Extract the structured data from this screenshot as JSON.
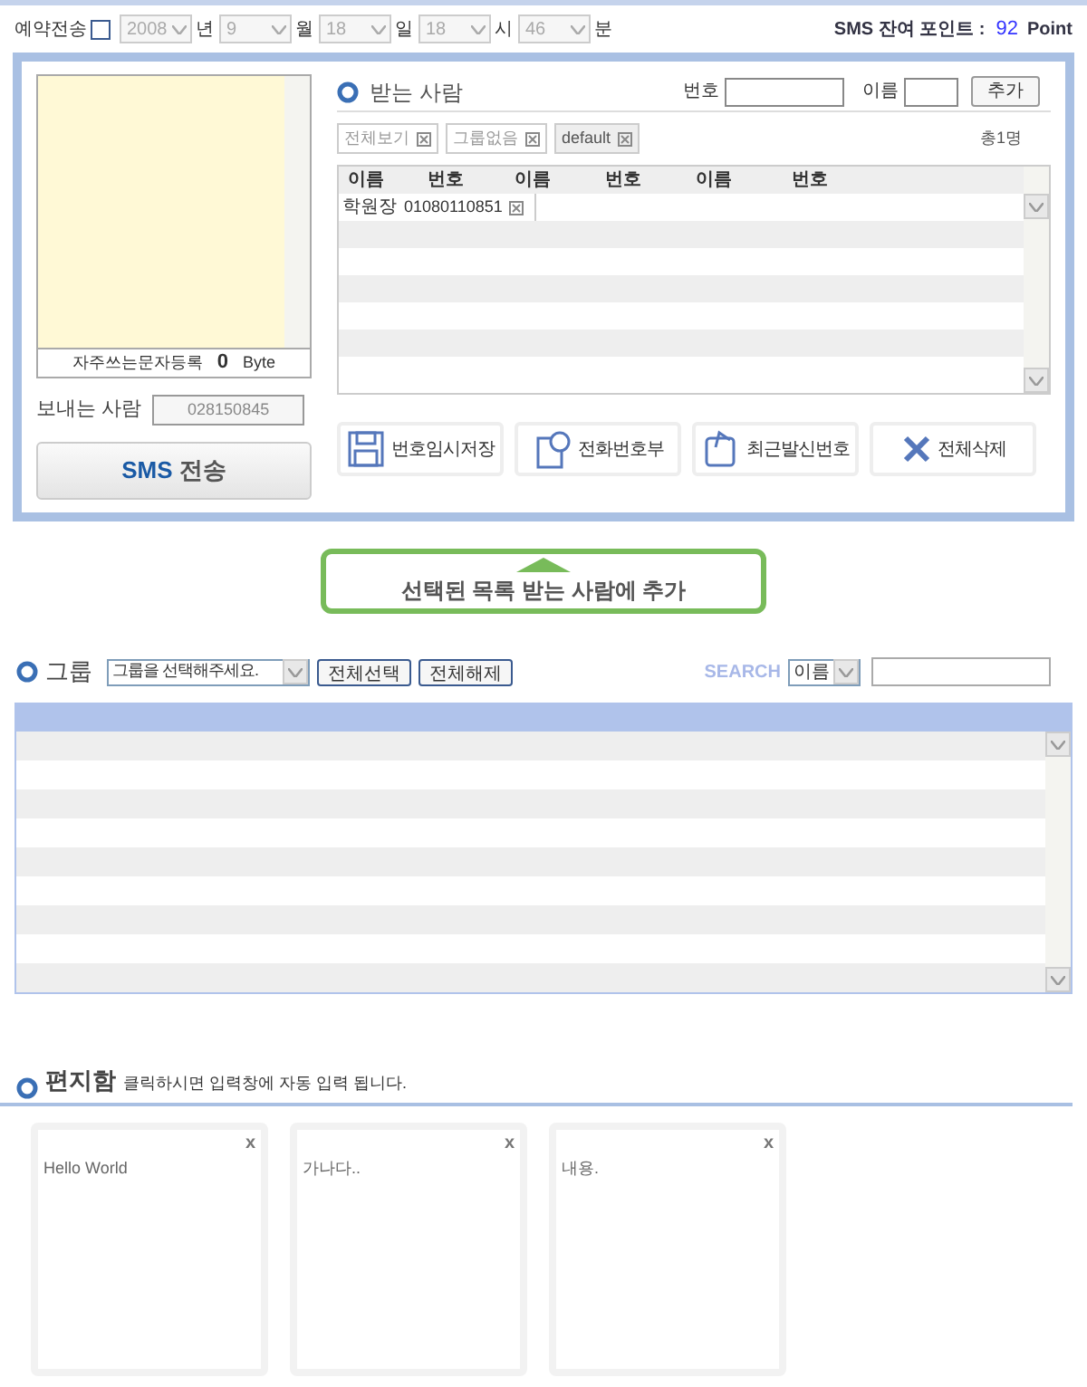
{
  "reservation": {
    "label": "예약전송",
    "checked": false,
    "disabled": true,
    "fields": [
      {
        "value": "2008",
        "unit": "년"
      },
      {
        "value": "9",
        "unit": "월"
      },
      {
        "value": "18",
        "unit": "일"
      },
      {
        "value": "18",
        "unit": "시"
      },
      {
        "value": "46",
        "unit": "분"
      }
    ]
  },
  "points": {
    "label": "SMS 잔여 포인트 :",
    "value": "92",
    "unit": "Point"
  },
  "message": {
    "counter_label": "자주쓰는문자등록",
    "bytes": "0",
    "byte_unit": "Byte"
  },
  "sender": {
    "label": "보내는 사람",
    "value": "028150845"
  },
  "send_button": {
    "prefix": "SMS",
    "label": "전송"
  },
  "recipients": {
    "title": "받는 사람",
    "number_label": "번호",
    "name_label": "이름",
    "add_button": "추가",
    "total": "총1명",
    "filters": [
      {
        "label": "전체보기",
        "selected": false
      },
      {
        "label": "그룹없음",
        "selected": false
      },
      {
        "label": "default",
        "selected": true
      }
    ],
    "columns": [
      "이름",
      "번호",
      "이름",
      "번호",
      "이름",
      "번호"
    ],
    "rows": [
      {
        "name": "학원장",
        "number": "01080110851"
      }
    ]
  },
  "actions": [
    {
      "kind": "save",
      "label": "번호임시저장"
    },
    {
      "kind": "book",
      "label": "전화번호부"
    },
    {
      "kind": "recent",
      "label": "최근발신번호"
    },
    {
      "kind": "delete",
      "label": "전체삭제"
    }
  ],
  "add_selected_button": "선택된 목록 받는 사람에 추가",
  "group": {
    "title": "그룹",
    "select": "그룹을 선택해주세요.",
    "buttons": [
      "전체선택",
      "전체해제"
    ],
    "search_label": "SEARCH",
    "search_select": "이름"
  },
  "letterbox": {
    "title": "편지함",
    "hint": "클릭하시면 입력창에 자동 입력 됩니다.",
    "cards": [
      {
        "text": "Hello World",
        "close": "x"
      },
      {
        "text": "가나다..",
        "close": "x"
      },
      {
        "text": "내용.",
        "close": "x"
      }
    ]
  }
}
